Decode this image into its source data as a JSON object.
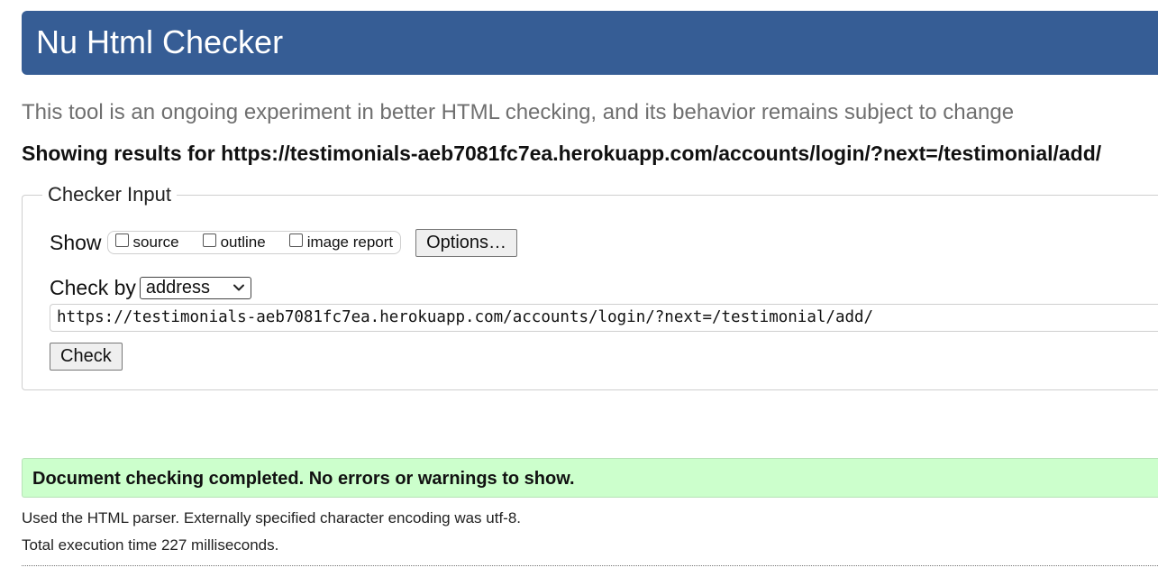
{
  "header": {
    "title": "Nu Html Checker"
  },
  "subtitle": "This tool is an ongoing experiment in better HTML checking, and its behavior remains subject to change",
  "results_for": "Showing results for https://testimonials-aeb7081fc7ea.herokuapp.com/accounts/login/?next=/testimonial/add/",
  "checker_input": {
    "legend": "Checker Input",
    "show_label": "Show",
    "show_options": [
      {
        "label": "source",
        "checked": false
      },
      {
        "label": "outline",
        "checked": false
      },
      {
        "label": "image report",
        "checked": false
      }
    ],
    "options_button": "Options…",
    "check_by_label": "Check by",
    "check_by_selected": "address",
    "url_value": "https://testimonials-aeb7081fc7ea.herokuapp.com/accounts/login/?next=/testimonial/add/",
    "check_button": "Check"
  },
  "result": {
    "message": "Document checking completed. No errors or warnings to show.",
    "color": "#ccffcc"
  },
  "info": {
    "parser": "Used the HTML parser. Externally specified character encoding was utf-8.",
    "execution_time": "Total execution time 227 milliseconds."
  },
  "colors": {
    "header_bg": "#365d95",
    "subtitle_text": "#6f6f6f"
  },
  "icons": {
    "select_chevron": "chevron-down-icon"
  }
}
